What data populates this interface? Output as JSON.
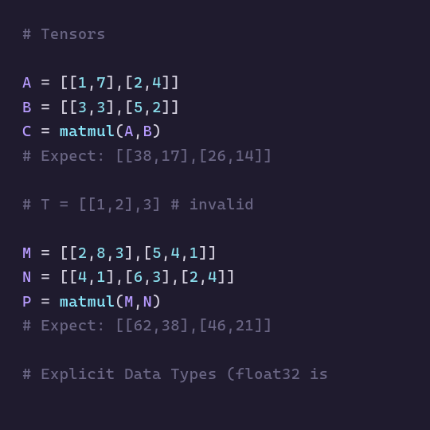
{
  "lines": [
    {
      "tokens": [
        {
          "cls": "c-comment",
          "t": "# Tensors"
        }
      ]
    },
    {
      "tokens": [
        {
          "cls": "c-plain",
          "t": ""
        }
      ]
    },
    {
      "tokens": [
        {
          "cls": "c-ident",
          "t": "A"
        },
        {
          "cls": "c-plain",
          "t": " "
        },
        {
          "cls": "c-op",
          "t": "="
        },
        {
          "cls": "c-plain",
          "t": " "
        },
        {
          "cls": "c-bracket",
          "t": "[["
        },
        {
          "cls": "c-num",
          "t": "1"
        },
        {
          "cls": "c-bracket",
          "t": ","
        },
        {
          "cls": "c-num",
          "t": "7"
        },
        {
          "cls": "c-bracket",
          "t": "],["
        },
        {
          "cls": "c-num",
          "t": "2"
        },
        {
          "cls": "c-bracket",
          "t": ","
        },
        {
          "cls": "c-num",
          "t": "4"
        },
        {
          "cls": "c-bracket",
          "t": "]]"
        }
      ]
    },
    {
      "tokens": [
        {
          "cls": "c-ident",
          "t": "B"
        },
        {
          "cls": "c-plain",
          "t": " "
        },
        {
          "cls": "c-op",
          "t": "="
        },
        {
          "cls": "c-plain",
          "t": " "
        },
        {
          "cls": "c-bracket",
          "t": "[["
        },
        {
          "cls": "c-num",
          "t": "3"
        },
        {
          "cls": "c-bracket",
          "t": ","
        },
        {
          "cls": "c-num",
          "t": "3"
        },
        {
          "cls": "c-bracket",
          "t": "],["
        },
        {
          "cls": "c-num",
          "t": "5"
        },
        {
          "cls": "c-bracket",
          "t": ","
        },
        {
          "cls": "c-num",
          "t": "2"
        },
        {
          "cls": "c-bracket",
          "t": "]]"
        }
      ]
    },
    {
      "tokens": [
        {
          "cls": "c-ident",
          "t": "C"
        },
        {
          "cls": "c-plain",
          "t": " "
        },
        {
          "cls": "c-op",
          "t": "="
        },
        {
          "cls": "c-plain",
          "t": " "
        },
        {
          "cls": "c-func",
          "t": "matmul"
        },
        {
          "cls": "c-bracket",
          "t": "("
        },
        {
          "cls": "c-ident",
          "t": "A"
        },
        {
          "cls": "c-bracket",
          "t": ","
        },
        {
          "cls": "c-ident",
          "t": "B"
        },
        {
          "cls": "c-bracket",
          "t": ")"
        }
      ]
    },
    {
      "tokens": [
        {
          "cls": "c-comment",
          "t": "# Expect: [[38,17],[26,14]]"
        }
      ]
    },
    {
      "tokens": [
        {
          "cls": "c-plain",
          "t": ""
        }
      ]
    },
    {
      "tokens": [
        {
          "cls": "c-comment",
          "t": "# T = [[1,2],3] # invalid"
        }
      ]
    },
    {
      "tokens": [
        {
          "cls": "c-plain",
          "t": ""
        }
      ]
    },
    {
      "tokens": [
        {
          "cls": "c-ident",
          "t": "M"
        },
        {
          "cls": "c-plain",
          "t": " "
        },
        {
          "cls": "c-op",
          "t": "="
        },
        {
          "cls": "c-plain",
          "t": " "
        },
        {
          "cls": "c-bracket",
          "t": "[["
        },
        {
          "cls": "c-num",
          "t": "2"
        },
        {
          "cls": "c-bracket",
          "t": ","
        },
        {
          "cls": "c-num",
          "t": "8"
        },
        {
          "cls": "c-bracket",
          "t": ","
        },
        {
          "cls": "c-num",
          "t": "3"
        },
        {
          "cls": "c-bracket",
          "t": "],["
        },
        {
          "cls": "c-num",
          "t": "5"
        },
        {
          "cls": "c-bracket",
          "t": ","
        },
        {
          "cls": "c-num",
          "t": "4"
        },
        {
          "cls": "c-bracket",
          "t": ","
        },
        {
          "cls": "c-num",
          "t": "1"
        },
        {
          "cls": "c-bracket",
          "t": "]]"
        }
      ]
    },
    {
      "tokens": [
        {
          "cls": "c-ident",
          "t": "N"
        },
        {
          "cls": "c-plain",
          "t": " "
        },
        {
          "cls": "c-op",
          "t": "="
        },
        {
          "cls": "c-plain",
          "t": " "
        },
        {
          "cls": "c-bracket",
          "t": "[["
        },
        {
          "cls": "c-num",
          "t": "4"
        },
        {
          "cls": "c-bracket",
          "t": ","
        },
        {
          "cls": "c-num",
          "t": "1"
        },
        {
          "cls": "c-bracket",
          "t": "],["
        },
        {
          "cls": "c-num",
          "t": "6"
        },
        {
          "cls": "c-bracket",
          "t": ","
        },
        {
          "cls": "c-num",
          "t": "3"
        },
        {
          "cls": "c-bracket",
          "t": "],["
        },
        {
          "cls": "c-num",
          "t": "2"
        },
        {
          "cls": "c-bracket",
          "t": ","
        },
        {
          "cls": "c-num",
          "t": "4"
        },
        {
          "cls": "c-bracket",
          "t": "]]"
        }
      ]
    },
    {
      "tokens": [
        {
          "cls": "c-ident",
          "t": "P"
        },
        {
          "cls": "c-plain",
          "t": " "
        },
        {
          "cls": "c-op",
          "t": "="
        },
        {
          "cls": "c-plain",
          "t": " "
        },
        {
          "cls": "c-func",
          "t": "matmul"
        },
        {
          "cls": "c-bracket",
          "t": "("
        },
        {
          "cls": "c-ident",
          "t": "M"
        },
        {
          "cls": "c-bracket",
          "t": ","
        },
        {
          "cls": "c-ident",
          "t": "N"
        },
        {
          "cls": "c-bracket",
          "t": ")"
        }
      ]
    },
    {
      "tokens": [
        {
          "cls": "c-comment",
          "t": "# Expect: [[62,38],[46,21]]"
        }
      ]
    },
    {
      "tokens": [
        {
          "cls": "c-plain",
          "t": ""
        }
      ]
    },
    {
      "tokens": [
        {
          "cls": "c-comment",
          "t": "# Explicit Data Types (float32 is "
        }
      ]
    }
  ]
}
